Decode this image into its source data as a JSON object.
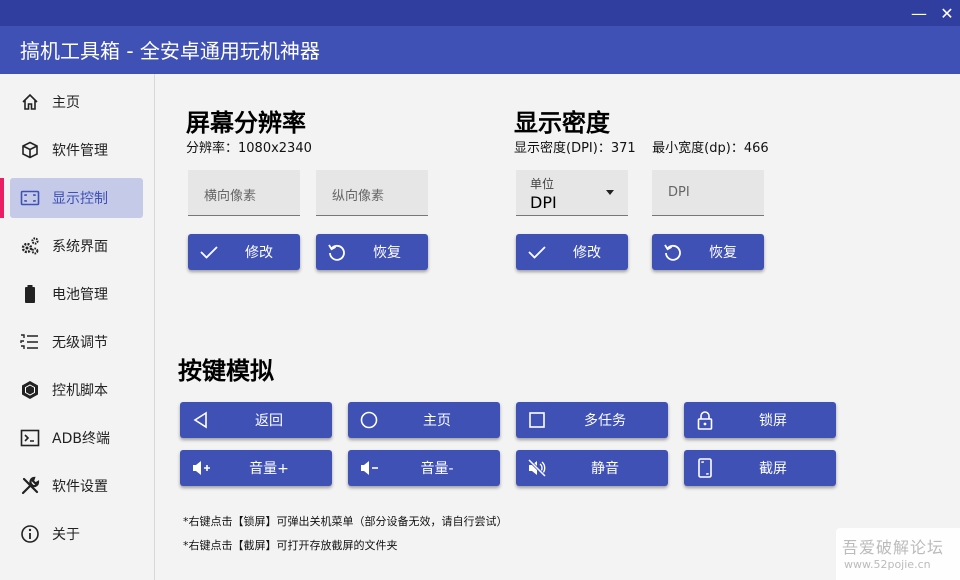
{
  "window": {
    "title": "搞机工具箱 - 全安卓通用玩机神器",
    "minimize": "—",
    "close": "✕"
  },
  "sidebar": {
    "items": [
      {
        "label": "主页",
        "icon": "home-icon"
      },
      {
        "label": "软件管理",
        "icon": "cube-icon"
      },
      {
        "label": "显示控制",
        "icon": "screen-icon",
        "active": true
      },
      {
        "label": "系统界面",
        "icon": "gears-icon"
      },
      {
        "label": "电池管理",
        "icon": "battery-icon"
      },
      {
        "label": "无级调节",
        "icon": "slider-icon"
      },
      {
        "label": "控机脚本",
        "icon": "hexagon-icon"
      },
      {
        "label": "ADB终端",
        "icon": "terminal-icon"
      },
      {
        "label": "软件设置",
        "icon": "tools-icon"
      },
      {
        "label": "关于",
        "icon": "info-icon"
      }
    ]
  },
  "resolution": {
    "title": "屏幕分辨率",
    "info": "分辨率：1080x2340",
    "width_placeholder": "横向像素",
    "height_placeholder": "纵向像素",
    "apply_label": "修改",
    "restore_label": "恢复"
  },
  "density": {
    "title": "显示密度",
    "info": "显示密度(DPI)：371    最小宽度(dp)：466",
    "unit_label": "单位",
    "unit_value": "DPI",
    "value_placeholder": "DPI",
    "apply_label": "修改",
    "restore_label": "恢复"
  },
  "keys": {
    "title": "按键模拟",
    "buttons": [
      {
        "label": "返回",
        "icon": "back-triangle-icon"
      },
      {
        "label": "主页",
        "icon": "home-circle-icon"
      },
      {
        "label": "多任务",
        "icon": "square-icon"
      },
      {
        "label": "锁屏",
        "icon": "lock-icon"
      },
      {
        "label": "音量+",
        "icon": "volume-up-icon"
      },
      {
        "label": "音量-",
        "icon": "volume-down-icon"
      },
      {
        "label": "静音",
        "icon": "mute-icon"
      },
      {
        "label": "截屏",
        "icon": "screenshot-icon"
      }
    ],
    "notes": [
      "*右键点击【锁屏】可弹出关机菜单（部分设备无效，请自行尝试）",
      "*右键点击【截屏】可打开存放截屏的文件夹"
    ]
  },
  "watermark": {
    "line1": "吾爱破解论坛",
    "line2": "www.52pojie.cn"
  },
  "colors": {
    "primary": "#3f51b5",
    "title_bar_top": "#303f9f",
    "active_nav_bg": "#c5cae9",
    "active_indicator": "#e91e63"
  }
}
